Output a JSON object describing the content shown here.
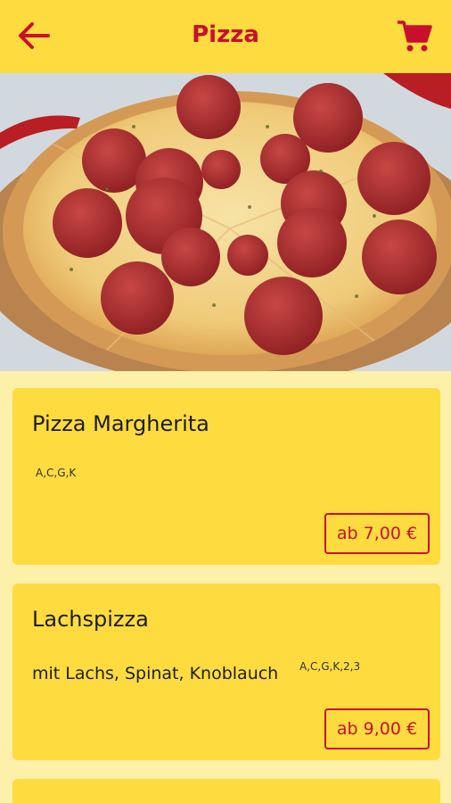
{
  "header": {
    "title": "Pizza",
    "back_icon": "arrow-left-icon",
    "cart_icon": "shopping-cart-icon"
  },
  "hero": {
    "image": "pepperoni-pizza-photo"
  },
  "menu": {
    "items": [
      {
        "name": "Pizza Margherita",
        "description": "",
        "allergens": "A,C,G,K",
        "price": "ab 7,00 €"
      },
      {
        "name": "Lachspizza",
        "description": "mit Lachs, Spinat, Knoblauch",
        "allergens": "A,C,G,K,2,3",
        "price": "ab 9,00 €"
      }
    ]
  },
  "colors": {
    "accent": "#C8102E",
    "header_bg": "#FEDB3F",
    "page_bg": "#FDF0A8",
    "card_bg": "#FEDB3F"
  }
}
